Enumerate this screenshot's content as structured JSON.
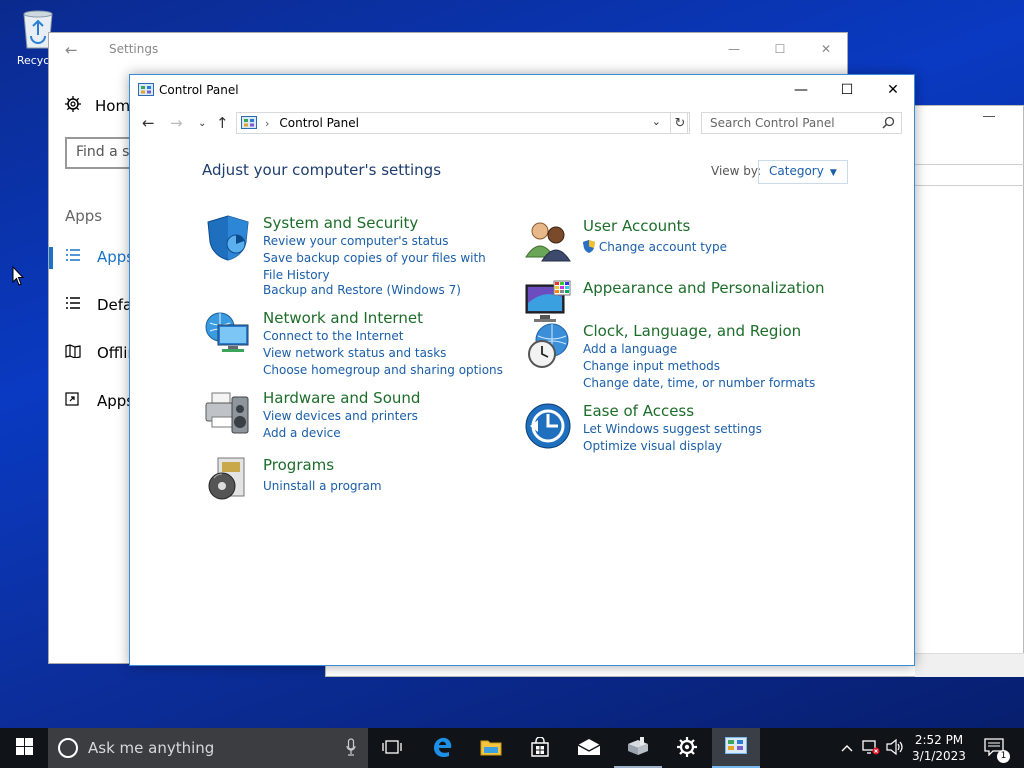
{
  "desktop": {
    "recycle_bin_label": "Recycle"
  },
  "settings_window": {
    "title": "Settings",
    "home_label": "Home",
    "search_placeholder": "Find a se",
    "section_header": "Apps",
    "nav": [
      {
        "label": "Apps",
        "icon": "apps-list-icon",
        "active": true
      },
      {
        "label": "Defau",
        "icon": "default-apps-icon",
        "active": false
      },
      {
        "label": "Offlin",
        "icon": "offline-maps-icon",
        "active": false
      },
      {
        "label": "Apps",
        "icon": "apps-websites-icon",
        "active": false
      }
    ]
  },
  "control_panel": {
    "title": "Control Panel",
    "address": {
      "crumb": "Control Panel"
    },
    "search_placeholder": "Search Control Panel",
    "heading": "Adjust your computer's settings",
    "view_by_label": "View by:",
    "view_by_value": "Category",
    "categories_left": [
      {
        "title": "System and Security",
        "icon": "shield-icon",
        "links": [
          "Review your computer's status",
          "Save backup copies of your files with File History",
          "Backup and Restore (Windows 7)"
        ]
      },
      {
        "title": "Network and Internet",
        "icon": "network-globe-icon",
        "links": [
          "Connect to the Internet",
          "View network status and tasks",
          "Choose homegroup and sharing options"
        ]
      },
      {
        "title": "Hardware and Sound",
        "icon": "printer-speaker-icon",
        "links": [
          "View devices and printers",
          "Add a device"
        ]
      },
      {
        "title": "Programs",
        "icon": "programs-disc-icon",
        "links": [
          "Uninstall a program"
        ]
      }
    ],
    "categories_right": [
      {
        "title": "User Accounts",
        "icon": "users-icon",
        "links": [
          "Change account type"
        ]
      },
      {
        "title": "Appearance and Personalization",
        "icon": "monitor-palette-icon",
        "links": []
      },
      {
        "title": "Clock, Language, and Region",
        "icon": "clock-globe-icon",
        "links": [
          "Add a language",
          "Change input methods",
          "Change date, time, or number formats"
        ]
      },
      {
        "title": "Ease of Access",
        "icon": "ease-of-access-icon",
        "links": [
          "Let Windows suggest settings",
          "Optimize visual display"
        ]
      }
    ]
  },
  "taskbar": {
    "search_placeholder": "Ask me anything",
    "pinned": [
      "task-view-icon",
      "edge-icon",
      "file-explorer-icon",
      "store-icon",
      "mail-icon",
      "server-manager-icon",
      "settings-gear-icon",
      "control-panel-icon"
    ],
    "clock": {
      "time": "2:52 PM",
      "date": "3/1/2023"
    },
    "notification_count": "1"
  }
}
